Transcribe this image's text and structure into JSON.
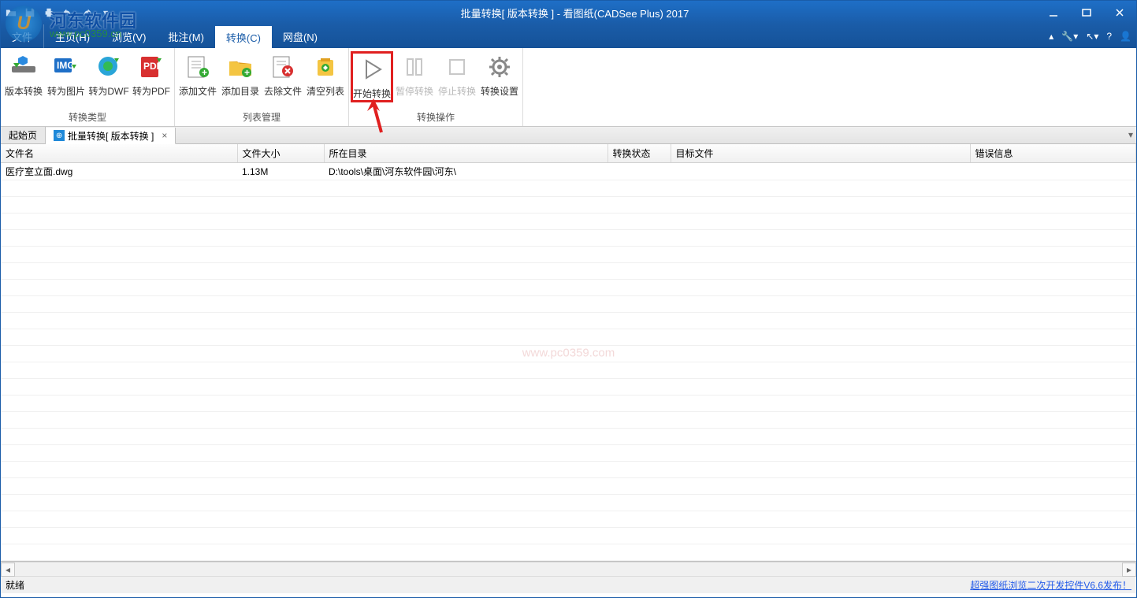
{
  "title": "批量转换[ 版本转换 ] - 看图纸(CADSee Plus) 2017",
  "menus": {
    "file": "文件",
    "home": "主页(H)",
    "browse": "浏览(V)",
    "annotate": "批注(M)",
    "convert": "转换(C)",
    "netdisk": "网盘(N)"
  },
  "ribbon": {
    "groups": {
      "type": "转换类型",
      "list": "列表管理",
      "op": "转换操作"
    },
    "buttons": {
      "ver": "版本转换",
      "img": "转为图片",
      "dwf": "转为DWF",
      "pdf": "转为PDF",
      "addfile": "添加文件",
      "adddir": "添加目录",
      "remove": "去除文件",
      "clear": "清空列表",
      "start": "开始转换",
      "pause": "暂停转换",
      "stop": "停止转换",
      "settings": "转换设置"
    }
  },
  "doctabs": {
    "start": "起始页",
    "batch": "批量转换[ 版本转换 ]"
  },
  "table": {
    "headers": {
      "name": "文件名",
      "size": "文件大小",
      "dir": "所在目录",
      "status": "转换状态",
      "target": "目标文件",
      "err": "错误信息"
    },
    "rows": [
      {
        "name": "医疗室立面.dwg",
        "size": "1.13M",
        "dir": "D:\\tools\\桌面\\河东软件园\\河东\\",
        "status": "",
        "target": "",
        "err": ""
      }
    ]
  },
  "watermark_center": "www.pc0359.com",
  "status": {
    "ready": "就绪",
    "link": "超强图纸浏览二次开发控件V6.6发布！"
  },
  "logo": {
    "name": "河东软件园",
    "url": "www.pc0359.cn"
  }
}
